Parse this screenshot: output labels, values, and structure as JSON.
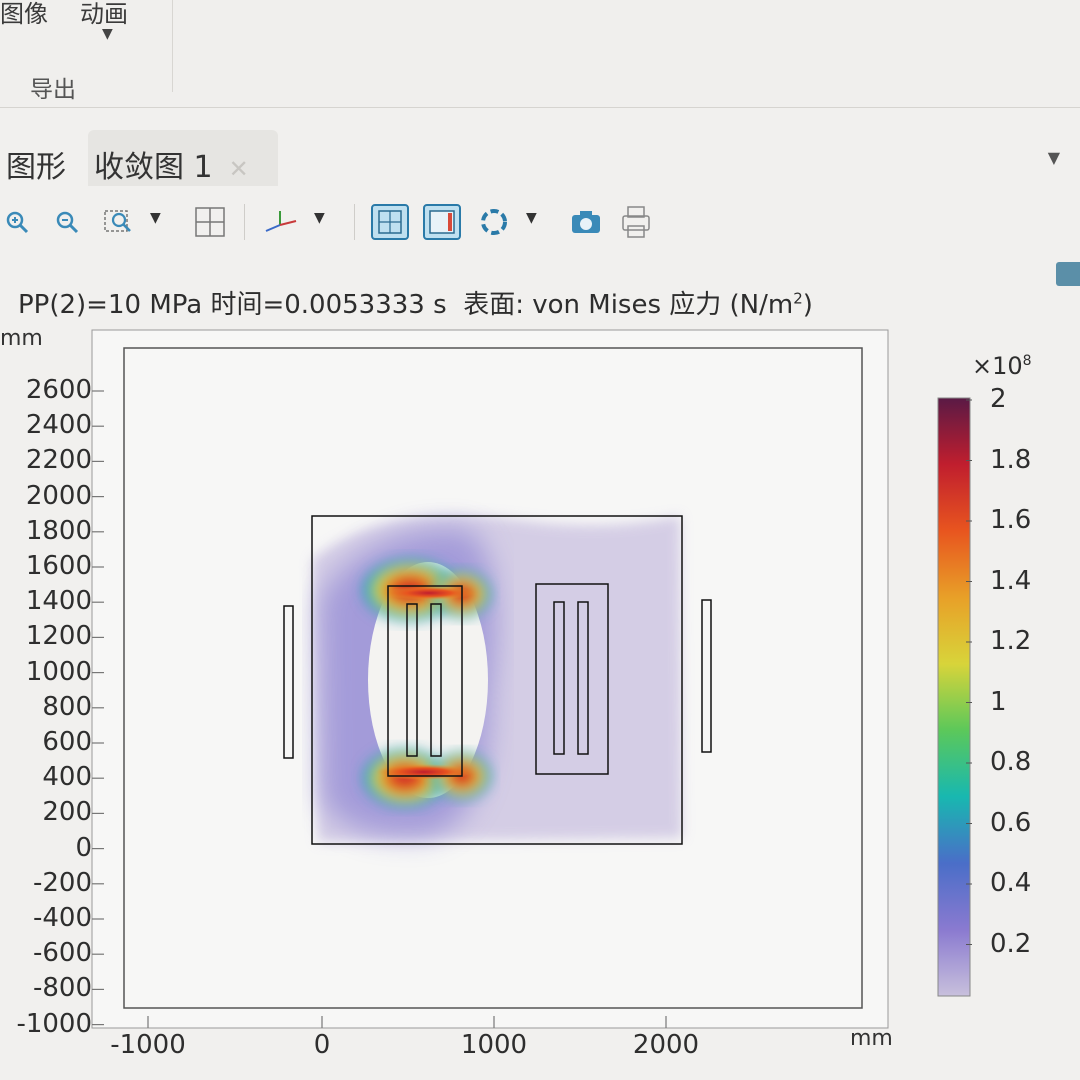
{
  "ribbon": {
    "item_image_partial": "图像",
    "item_animation": "动画",
    "group_export": "导出"
  },
  "tabs": [
    {
      "label": "图形"
    },
    {
      "label": "收敛图 1",
      "closable": true
    }
  ],
  "toolbar": {
    "buttons": [
      "zoom-in-icon",
      "zoom-out-icon",
      "zoom-box-icon",
      "zoom-extents-icon",
      "axis-orientation-icon",
      "grid-icon",
      "frame-icon",
      "refresh-icon",
      "camera-icon",
      "print-icon"
    ]
  },
  "plot": {
    "title_prefix": "PP(2)=10 MPa 时间=0.0053333 s",
    "title_suffix": "表面: von Mises 应力 (N/m",
    "title_sup": "2",
    "title_close": ")",
    "y_unit": "mm",
    "x_unit": "mm",
    "y_ticks": [
      "2600",
      "2400",
      "2200",
      "2000",
      "1800",
      "1600",
      "1400",
      "1200",
      "1000",
      "800",
      "600",
      "400",
      "200",
      "0",
      "-200",
      "-400",
      "-600",
      "-800",
      "-1000"
    ],
    "x_ticks": [
      "-1000",
      "0",
      "1000",
      "2000"
    ]
  },
  "colorbar": {
    "title_base": "×10",
    "title_exp": "8",
    "ticks": [
      "2",
      "1.8",
      "1.6",
      "1.4",
      "1.2",
      "1",
      "0.8",
      "0.6",
      "0.4",
      "0.2"
    ],
    "colors": [
      "#5a1a45",
      "#c01e2e",
      "#e8551f",
      "#e8a028",
      "#d8d43a",
      "#5cc85a",
      "#18b8b0",
      "#4a6ec8",
      "#8a7ad0",
      "#c8c0dc"
    ]
  },
  "chart_data": {
    "type": "heatmap",
    "title": "PP(2)=10 MPa 时间=0.0053333 s 表面: von Mises 应力 (N/m²)",
    "xlabel": "mm",
    "ylabel": "mm",
    "xlim": [
      -1100,
      2400
    ],
    "ylim": [
      -1000,
      2800
    ],
    "x_ticks": [
      -1000,
      0,
      1000,
      2000
    ],
    "y_ticks": [
      2600,
      2400,
      2200,
      2000,
      1800,
      1600,
      1400,
      1200,
      1000,
      800,
      600,
      400,
      200,
      0,
      -200,
      -400,
      -600,
      -800,
      -1000
    ],
    "colorbar": {
      "min": 0.2,
      "max": 2,
      "multiplier": "×10^8",
      "ticks": [
        2,
        1.8,
        1.6,
        1.4,
        1.2,
        1,
        0.8,
        0.6,
        0.4,
        0.2
      ]
    }
  }
}
